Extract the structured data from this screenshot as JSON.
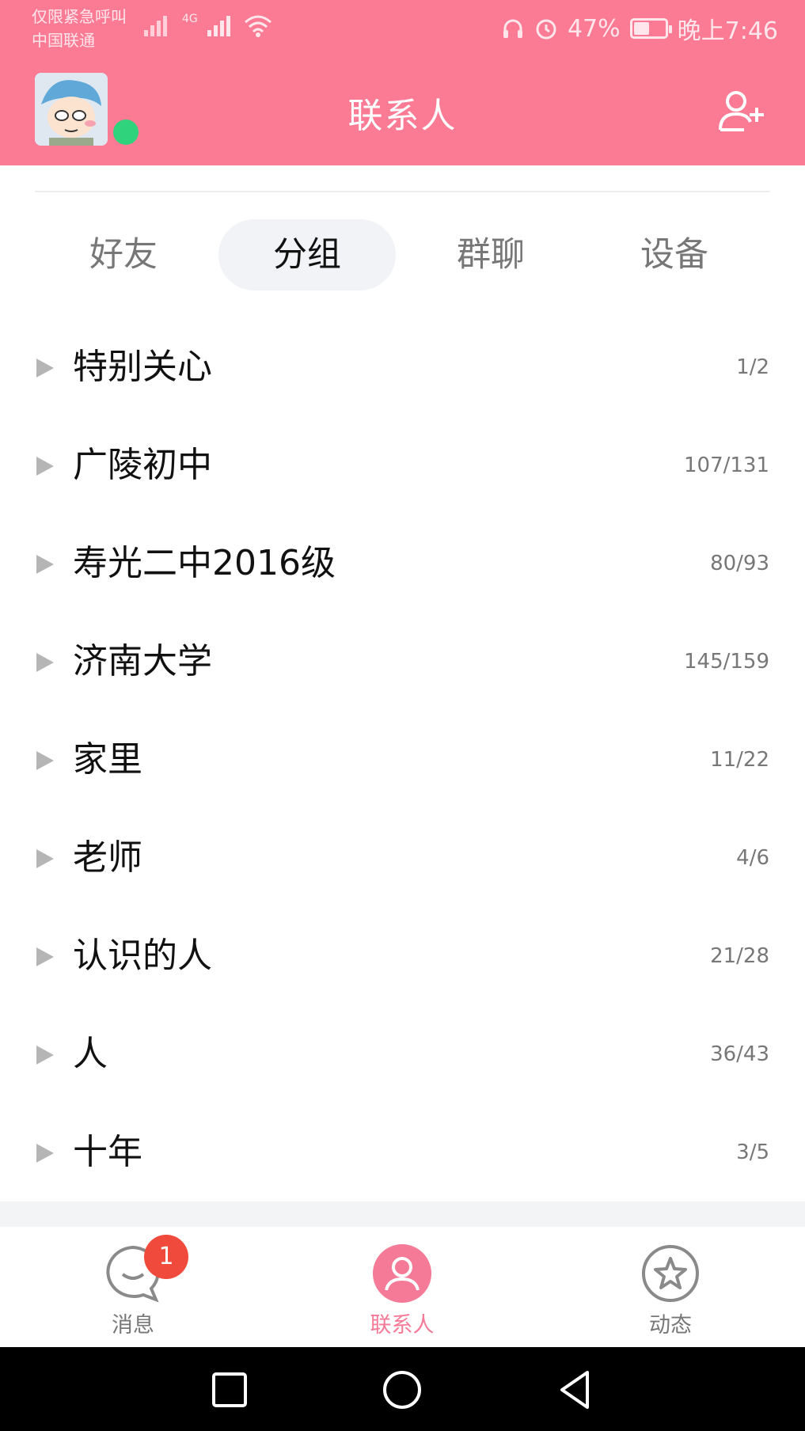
{
  "status_bar": {
    "carrier_line1": "仅限紧急呼叫",
    "carrier_line2": "中国联通",
    "network": "4G",
    "battery_percent": "47%",
    "battery_level": 0.47,
    "time": "晚上7:46"
  },
  "header": {
    "title": "联系人",
    "accent_color": "#fb7b95"
  },
  "tabs": [
    {
      "label": "好友",
      "active": false
    },
    {
      "label": "分组",
      "active": true
    },
    {
      "label": "群聊",
      "active": false
    },
    {
      "label": "设备",
      "active": false
    }
  ],
  "groups": [
    {
      "name": "特别关心",
      "count": "1/2"
    },
    {
      "name": "广陵初中",
      "count": "107/131"
    },
    {
      "name": "寿光二中2016级",
      "count": "80/93"
    },
    {
      "name": "济南大学",
      "count": "145/159"
    },
    {
      "name": "家里",
      "count": "11/22"
    },
    {
      "name": "老师",
      "count": "4/6"
    },
    {
      "name": "认识的人",
      "count": "21/28"
    },
    {
      "name": "人",
      "count": "36/43"
    },
    {
      "name": "十年",
      "count": "3/5"
    }
  ],
  "bottom_nav": {
    "items": [
      {
        "label": "消息",
        "icon": "message-icon",
        "active": false
      },
      {
        "label": "联系人",
        "icon": "contacts-icon",
        "active": true
      },
      {
        "label": "动态",
        "icon": "star-icon",
        "active": false
      }
    ],
    "badge": "1"
  },
  "system_nav": [
    "recent-apps-icon",
    "home-icon",
    "back-icon"
  ]
}
